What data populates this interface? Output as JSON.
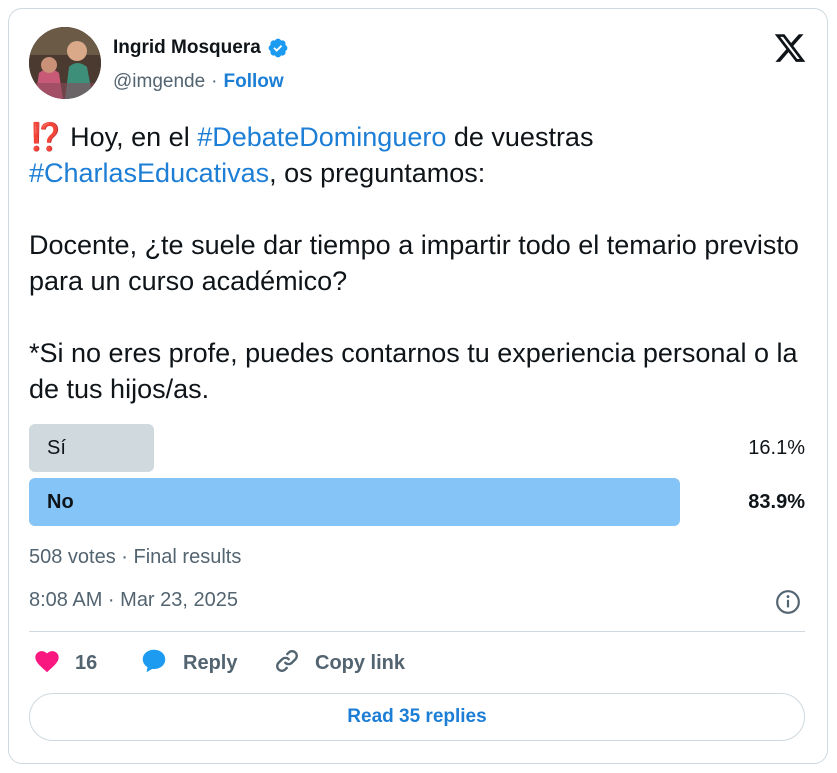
{
  "author": {
    "name": "Ingrid Mosquera",
    "handle": "@imgende",
    "separator": "·",
    "follow_label": "Follow"
  },
  "tweet": {
    "emoji": "⁉️",
    "line1_pre": " Hoy, en el ",
    "hashtag1": "#DebateDominguero",
    "line1_post": " de vuestras",
    "hashtag2": "#CharlasEducativas",
    "line2_post": ", os preguntamos:",
    "paragraph2": "Docente, ¿te suele dar tiempo a impartir todo el temario previsto para un curso académico?",
    "paragraph3": "*Si no eres profe, puedes contarnos tu experiencia personal o la de tus hijos/as."
  },
  "poll": {
    "options": [
      {
        "label": "Sí",
        "percent_label": "16.1%",
        "percent": 16.1
      },
      {
        "label": "No",
        "percent_label": "83.9%",
        "percent": 83.9
      }
    ],
    "summary": "508 votes · Final results"
  },
  "timestamp": "8:08 AM · Mar 23, 2025",
  "actions": {
    "like_count": "16",
    "reply_label": "Reply",
    "copy_label": "Copy link"
  },
  "read_replies_label": "Read 35 replies",
  "colors": {
    "link": "#1d7ed6",
    "like": "#f91880",
    "winning_bar": "#84c4f7",
    "losing_bar": "#cfd9de"
  },
  "icons": [
    "verified-badge-icon",
    "x-logo-icon",
    "info-icon",
    "heart-icon",
    "reply-icon",
    "link-icon"
  ]
}
